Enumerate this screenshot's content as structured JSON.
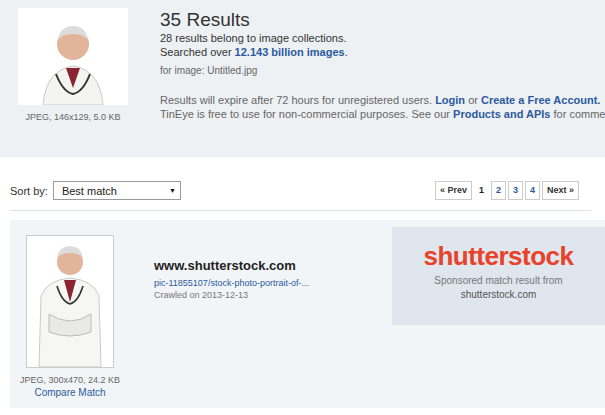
{
  "query": {
    "image_caption": "JPEG, 146x129, 5.0 KB",
    "results_count": "35 Results",
    "collections_note": "28 results belong to image collections.",
    "searched_prefix": "Searched over",
    "searched_count": "12.143 billion images",
    "searched_suffix": ".",
    "for_image": "for image: Untitled.jpg",
    "expire_text": "Results will expire after 72 hours for unregistered users.",
    "login": "Login",
    "or": "or",
    "create_account": "Create a Free Account.",
    "free_text": "TinEye is free to use for non-commercial purposes. See our",
    "products": "Products and APIs",
    "free_suffix": "for comme"
  },
  "sort": {
    "label": "Sort by:",
    "value": "Best match",
    "arrow": "▼"
  },
  "pagination": [
    {
      "label": "« Prev",
      "selected": false
    },
    {
      "label": "1",
      "selected": true
    },
    {
      "label": "2",
      "selected": false
    },
    {
      "label": "3",
      "selected": false
    },
    {
      "label": "4",
      "selected": false
    },
    {
      "label": "Next »",
      "selected": false
    }
  ],
  "results": [
    {
      "image_caption": "JPEG, 300x470, 24.2 KB",
      "compare": "Compare Match",
      "domain": "www.shutterstock.com",
      "link": "pic-11855107/stock-photo-portrait-of-...",
      "crawled": "Crawled on 2013-12-13",
      "sponsor": {
        "logo": "shutterstock",
        "note": "Sponsored match result from",
        "site": "shutterstock.com"
      }
    }
  ]
}
